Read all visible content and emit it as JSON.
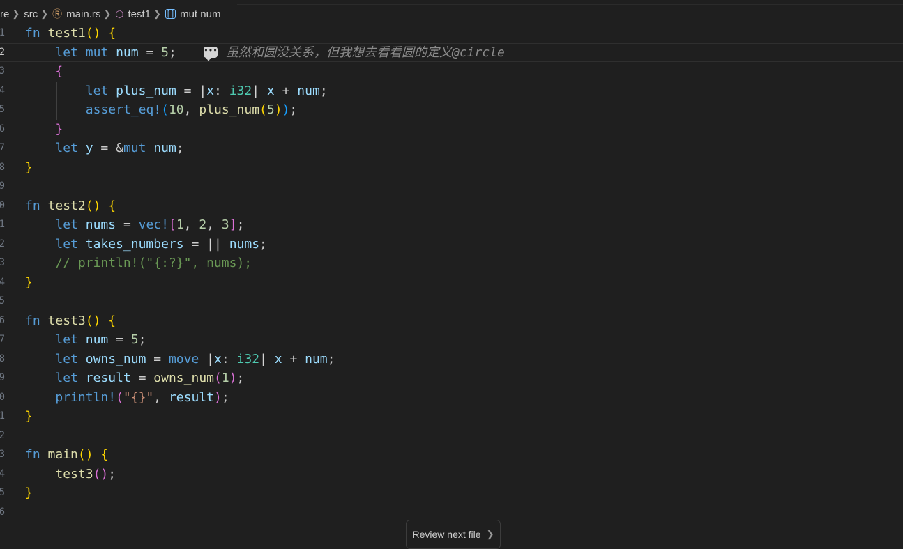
{
  "breadcrumb": {
    "items": [
      "re",
      "src",
      "main.rs",
      "test1",
      "mut num"
    ],
    "icons": [
      "chevron-right-icon",
      "rust-file-icon",
      "module-icon",
      "variable-icon"
    ]
  },
  "inline_comment": {
    "text": "虽然和圆没关系，但我想去看看圆的定义@circle",
    "icon": "comment-icon"
  },
  "review_button": {
    "label": "Review next file",
    "icon": "chevron-right-icon"
  },
  "editor": {
    "active_line": "2",
    "line_numbers": [
      "1",
      "2",
      "3",
      "4",
      "5",
      "6",
      "7",
      "8",
      "9",
      "0",
      "1",
      "2",
      "3",
      "4",
      "5",
      "6",
      "7",
      "8",
      "9",
      "0",
      "1",
      "2",
      "3",
      "4",
      "5",
      "6"
    ],
    "lines": [
      "fn test1() {",
      "    let mut num = 5;",
      "    {",
      "        let plus_num = |x: i32| x + num;",
      "        assert_eq!(10, plus_num(5));",
      "    }",
      "    let y = &mut num;",
      "}",
      "",
      "fn test2() {",
      "    let nums = vec![1, 2, 3];",
      "    let takes_numbers = || nums;",
      "    // println!(\"{:?}\", nums);",
      "}",
      "",
      "fn test3() {",
      "    let num = 5;",
      "    let owns_num = move |x: i32| x + num;",
      "    let result = owns_num(1);",
      "    println!(\"{}\", result);",
      "}",
      "",
      "fn main() {",
      "    test3();",
      "}",
      ""
    ]
  },
  "colors": {
    "background": "#1f1f1f",
    "keyword": "#569cd6",
    "function": "#dcdcaa",
    "variable": "#9cdcfe",
    "number": "#b5cea8",
    "type": "#4ec9b0",
    "string": "#ce9178",
    "comment": "#6a9955",
    "bracket_gold": "#ffd700",
    "bracket_purple": "#da70d6",
    "bracket_blue": "#179fff"
  }
}
